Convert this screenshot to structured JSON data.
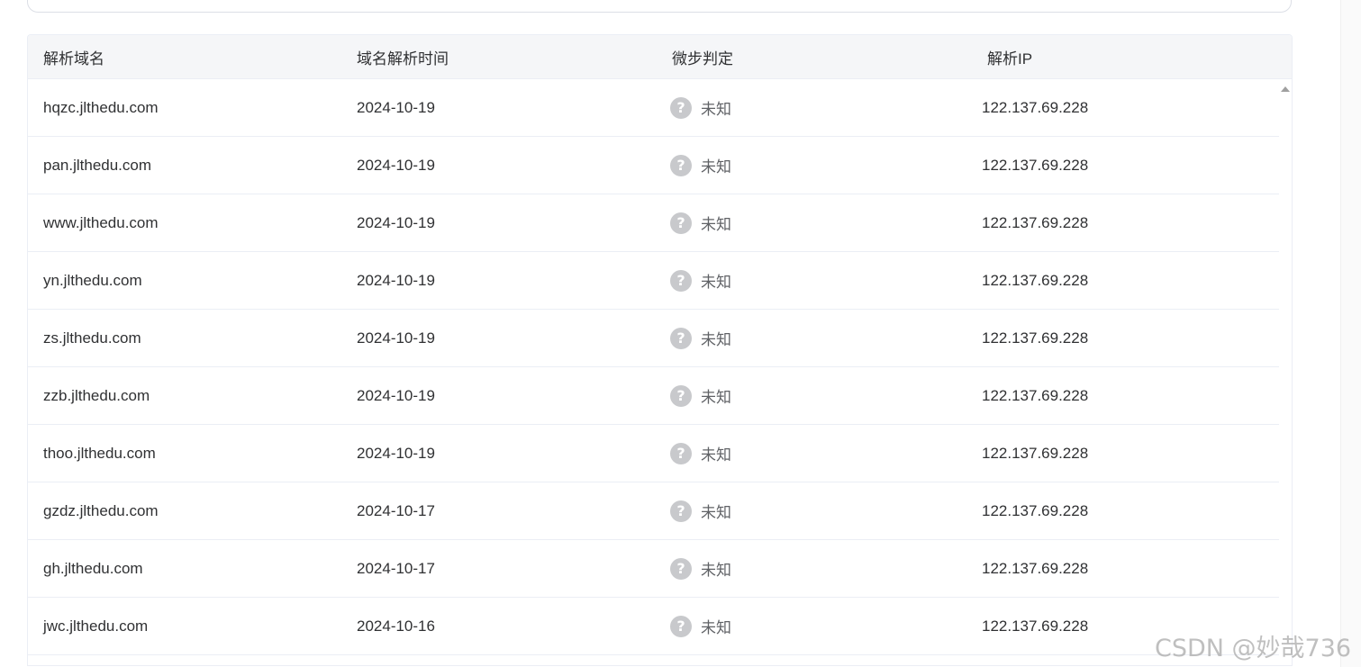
{
  "table": {
    "headers": [
      "解析域名",
      "域名解析时间",
      "微步判定",
      "解析IP"
    ],
    "rows": [
      {
        "domain": "hqzc.jlthedu.com",
        "date": "2024-10-19",
        "verdict": "未知",
        "ip": "122.137.69.228"
      },
      {
        "domain": "pan.jlthedu.com",
        "date": "2024-10-19",
        "verdict": "未知",
        "ip": "122.137.69.228"
      },
      {
        "domain": "www.jlthedu.com",
        "date": "2024-10-19",
        "verdict": "未知",
        "ip": "122.137.69.228"
      },
      {
        "domain": "yn.jlthedu.com",
        "date": "2024-10-19",
        "verdict": "未知",
        "ip": "122.137.69.228"
      },
      {
        "domain": "zs.jlthedu.com",
        "date": "2024-10-19",
        "verdict": "未知",
        "ip": "122.137.69.228"
      },
      {
        "domain": "zzb.jlthedu.com",
        "date": "2024-10-19",
        "verdict": "未知",
        "ip": "122.137.69.228"
      },
      {
        "domain": "thoo.jlthedu.com",
        "date": "2024-10-19",
        "verdict": "未知",
        "ip": "122.137.69.228"
      },
      {
        "domain": "gzdz.jlthedu.com",
        "date": "2024-10-17",
        "verdict": "未知",
        "ip": "122.137.69.228"
      },
      {
        "domain": "gh.jlthedu.com",
        "date": "2024-10-17",
        "verdict": "未知",
        "ip": "122.137.69.228"
      },
      {
        "domain": "jwc.jlthedu.com",
        "date": "2024-10-16",
        "verdict": "未知",
        "ip": "122.137.69.228"
      }
    ],
    "verdict_icon": "question-circle-icon",
    "verdict_icon_glyph": "?"
  },
  "watermark": "CSDN @妙哉736",
  "colors": {
    "header_bg": "#f5f6f8",
    "border": "#ebeef5",
    "icon_gray": "#c8c9cc",
    "text": "#303133"
  }
}
